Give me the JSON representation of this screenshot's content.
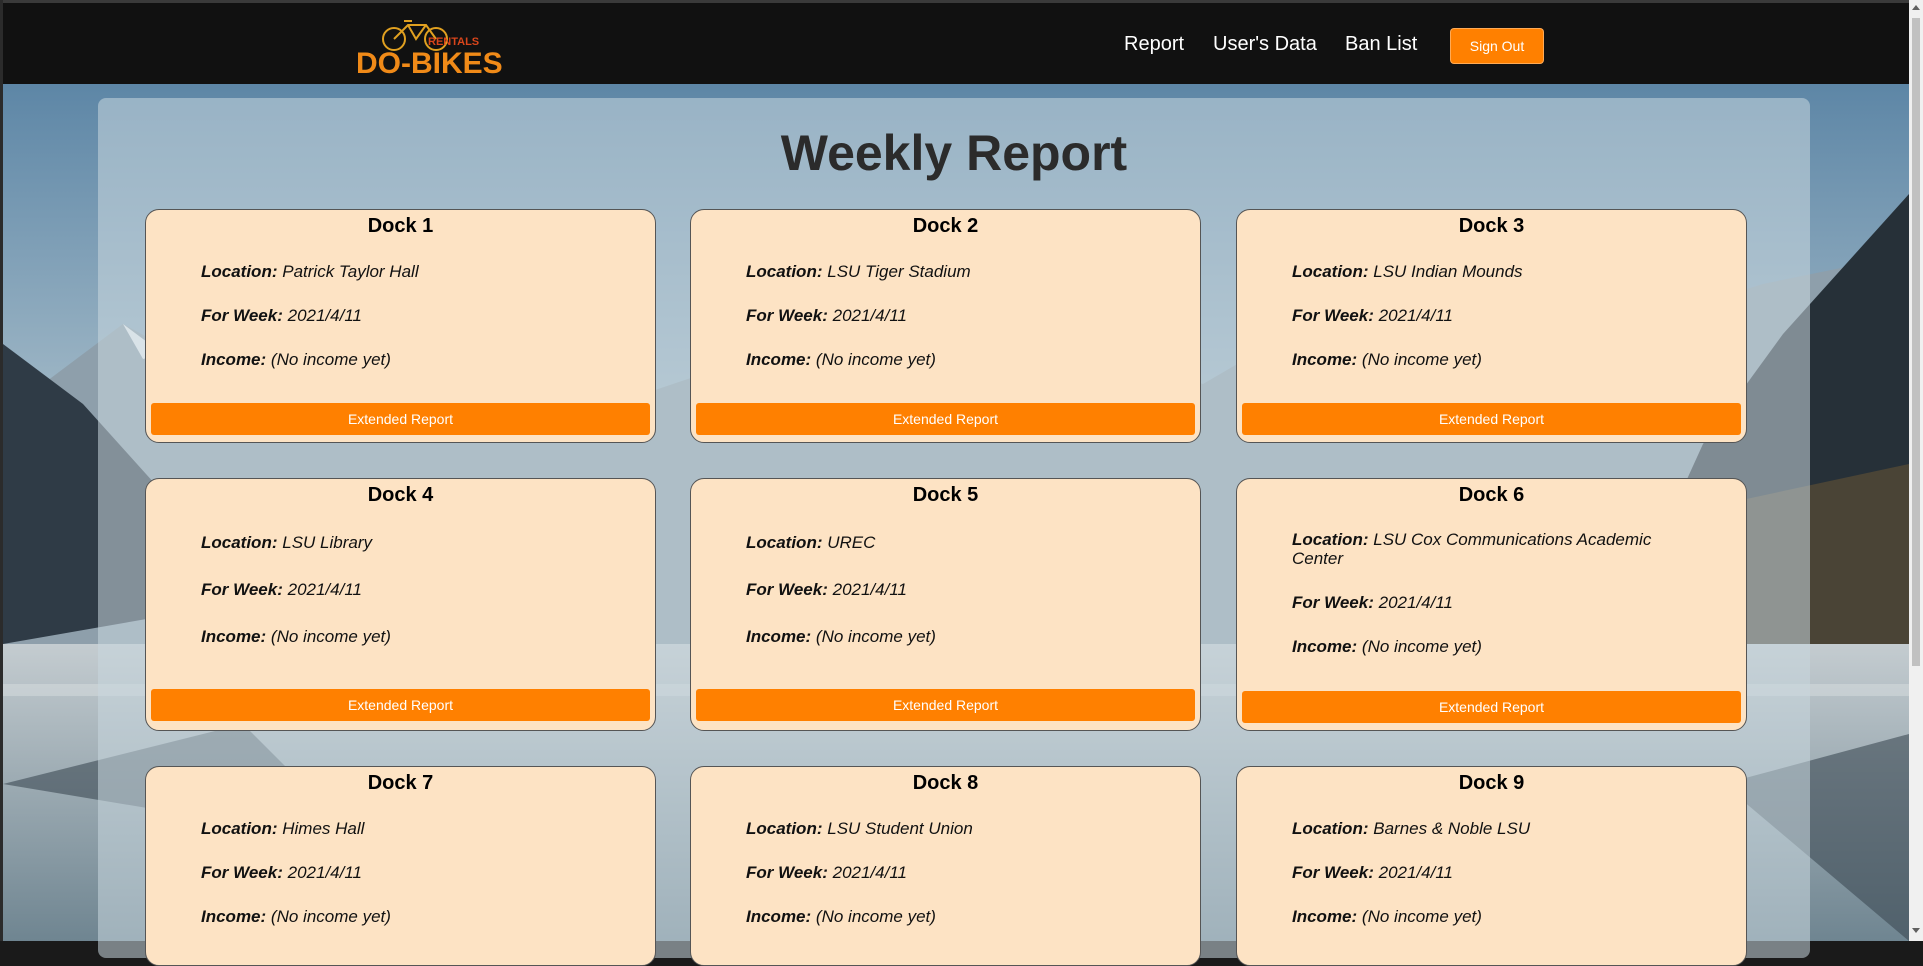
{
  "header": {
    "logo_text": "DO-BIKES",
    "logo_subtext": "RENTALS",
    "nav": [
      "Report",
      "User's Data",
      "Ban List"
    ],
    "signout_label": "Sign Out"
  },
  "main": {
    "title": "Weekly Report",
    "labels": {
      "location": "Location:",
      "week": "For Week:",
      "income": "Income:"
    },
    "button_label": "Extended Report",
    "docks": [
      {
        "name": "Dock 1",
        "location": "Patrick Taylor Hall",
        "week": "2021/4/11",
        "income": "(No income yet)"
      },
      {
        "name": "Dock 2",
        "location": "LSU Tiger Stadium",
        "week": "2021/4/11",
        "income": "(No income yet)"
      },
      {
        "name": "Dock 3",
        "location": "LSU Indian Mounds",
        "week": "2021/4/11",
        "income": "(No income yet)"
      },
      {
        "name": "Dock 4",
        "location": "LSU Library",
        "week": "2021/4/11",
        "income": "(No income yet)"
      },
      {
        "name": "Dock 5",
        "location": "UREC",
        "week": "2021/4/11",
        "income": "(No income yet)"
      },
      {
        "name": "Dock 6",
        "location": "LSU Cox Communications Academic Center",
        "week": "2021/4/11",
        "income": "(No income yet)"
      },
      {
        "name": "Dock 7",
        "location": "Himes Hall",
        "week": "2021/4/11",
        "income": "(No income yet)"
      },
      {
        "name": "Dock 8",
        "location": "LSU Student Union",
        "week": "2021/4/11",
        "income": "(No income yet)"
      },
      {
        "name": "Dock 9",
        "location": "Barnes & Noble LSU",
        "week": "2021/4/11",
        "income": "(No income yet)"
      }
    ]
  },
  "colors": {
    "accent": "#ff8000",
    "card_bg": "#fde3c4",
    "navbar": "#111111"
  }
}
